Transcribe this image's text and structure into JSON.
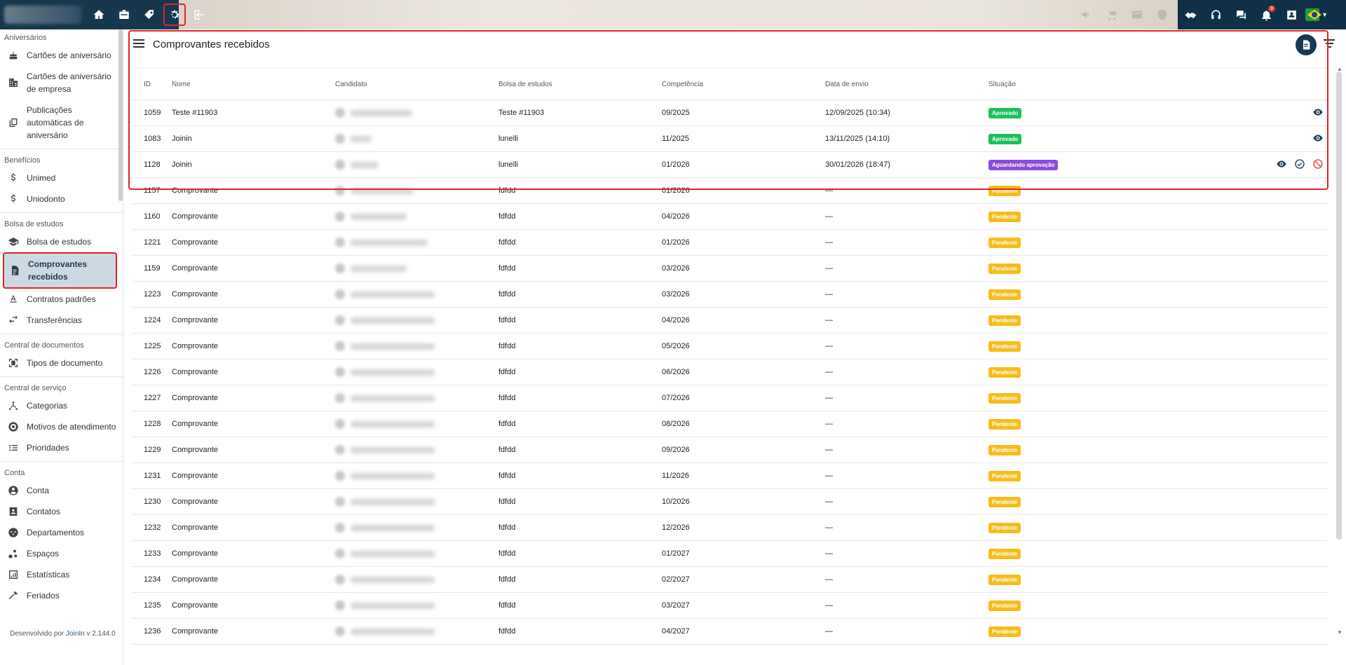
{
  "topbar": {
    "left_icons": [
      "home-icon",
      "briefcase-icon",
      "tag-icon",
      "gear-icon",
      "login-icon"
    ],
    "active_icon": "gear-icon",
    "mid_icons": [
      "megaphone-icon",
      "cart-icon",
      "card-icon",
      "shield-icon"
    ],
    "right_icons": [
      "handshake-icon",
      "headset-icon",
      "chat-icon",
      "bell-icon",
      "badge-icon"
    ],
    "notification_count": "9"
  },
  "sidebar": {
    "sections": [
      {
        "title": "Aniversários",
        "items": [
          {
            "label": "Cartões de aniversário",
            "icon": "cake-icon"
          },
          {
            "label": "Cartões de aniversário de empresa",
            "icon": "building-icon"
          },
          {
            "label": "Publicações automáticas de aniversário",
            "icon": "copy-icon"
          }
        ]
      },
      {
        "title": "Benefícios",
        "items": [
          {
            "label": "Unimed",
            "icon": "dollar-icon"
          },
          {
            "label": "Uniodonto",
            "icon": "dollar-icon"
          }
        ]
      },
      {
        "title": "Bolsa de estudos",
        "items": [
          {
            "label": "Bolsa de estudos",
            "icon": "graduation-icon"
          },
          {
            "label": "Comprovantes recebidos",
            "icon": "document-icon",
            "active": true
          },
          {
            "label": "Contratos padrões",
            "icon": "text-format-icon"
          },
          {
            "label": "Transferências",
            "icon": "swap-icon"
          }
        ]
      },
      {
        "title": "Central de documentos",
        "items": [
          {
            "label": "Tipos de documento",
            "icon": "doc-scan-icon"
          }
        ]
      },
      {
        "title": "Central de serviço",
        "items": [
          {
            "label": "Categorias",
            "icon": "hub-icon"
          },
          {
            "label": "Motivos de atendimento",
            "icon": "target-icon"
          },
          {
            "label": "Prioridades",
            "icon": "list-priority-icon"
          }
        ]
      },
      {
        "title": "Conta",
        "items": [
          {
            "label": "Conta",
            "icon": "account-icon"
          },
          {
            "label": "Contatos",
            "icon": "contacts-icon"
          },
          {
            "label": "Departamentos",
            "icon": "departments-icon"
          },
          {
            "label": "Espaços",
            "icon": "spaces-icon"
          },
          {
            "label": "Estatísticas",
            "icon": "stats-icon"
          },
          {
            "label": "Feriados",
            "icon": "holiday-icon"
          }
        ]
      }
    ],
    "footer_prefix": "Desenvolvido por",
    "footer_brand": "JoinIn",
    "footer_version": "v 2.144.0"
  },
  "main": {
    "title": "Comprovantes recebidos",
    "columns": [
      "ID",
      "Nome",
      "Candidato",
      "Bolsa de estudos",
      "Competência",
      "Data de envio",
      "Situação"
    ],
    "rows": [
      {
        "id": "1059",
        "nome": "Teste #11903",
        "bolsa": "Teste #11903",
        "comp": "09/2025",
        "data": "12/09/2025 (10:34)",
        "status": "Aprovado",
        "color": "green",
        "actions": [
          "view-icon"
        ]
      },
      {
        "id": "1083",
        "nome": "Joinin",
        "bolsa": "lunelli",
        "comp": "11/2025",
        "data": "13/11/2025 (14:10)",
        "status": "Aprovado",
        "color": "green",
        "actions": [
          "view-icon"
        ]
      },
      {
        "id": "1128",
        "nome": "Joinin",
        "bolsa": "lunelli",
        "comp": "01/2026",
        "data": "30/01/2026 (18:47)",
        "status": "Aguardando aprovação",
        "color": "purple",
        "actions": [
          "view-icon",
          "approve-icon",
          "reject-icon"
        ]
      },
      {
        "id": "1157",
        "nome": "Comprovante",
        "bolsa": "fdfdd",
        "comp": "01/2026",
        "data": "—",
        "status": "Pendente",
        "color": "yellow",
        "actions": []
      },
      {
        "id": "1160",
        "nome": "Comprovante",
        "bolsa": "fdfdd",
        "comp": "04/2026",
        "data": "—",
        "status": "Pendente",
        "color": "yellow",
        "actions": []
      },
      {
        "id": "1221",
        "nome": "Comprovante",
        "bolsa": "fdfdd",
        "comp": "01/2026",
        "data": "—",
        "status": "Pendente",
        "color": "yellow",
        "actions": []
      },
      {
        "id": "1159",
        "nome": "Comprovante",
        "bolsa": "fdfdd",
        "comp": "03/2026",
        "data": "—",
        "status": "Pendente",
        "color": "yellow",
        "actions": []
      },
      {
        "id": "1223",
        "nome": "Comprovante",
        "bolsa": "fdfdd",
        "comp": "03/2026",
        "data": "—",
        "status": "Pendente",
        "color": "yellow",
        "actions": []
      },
      {
        "id": "1224",
        "nome": "Comprovante",
        "bolsa": "fdfdd",
        "comp": "04/2026",
        "data": "—",
        "status": "Pendente",
        "color": "yellow",
        "actions": []
      },
      {
        "id": "1225",
        "nome": "Comprovante",
        "bolsa": "fdfdd",
        "comp": "05/2026",
        "data": "—",
        "status": "Pendente",
        "color": "yellow",
        "actions": []
      },
      {
        "id": "1226",
        "nome": "Comprovante",
        "bolsa": "fdfdd",
        "comp": "06/2026",
        "data": "—",
        "status": "Pendente",
        "color": "yellow",
        "actions": []
      },
      {
        "id": "1227",
        "nome": "Comprovante",
        "bolsa": "fdfdd",
        "comp": "07/2026",
        "data": "—",
        "status": "Pendente",
        "color": "yellow",
        "actions": []
      },
      {
        "id": "1228",
        "nome": "Comprovante",
        "bolsa": "fdfdd",
        "comp": "08/2026",
        "data": "—",
        "status": "Pendente",
        "color": "yellow",
        "actions": []
      },
      {
        "id": "1229",
        "nome": "Comprovante",
        "bolsa": "fdfdd",
        "comp": "09/2026",
        "data": "—",
        "status": "Pendente",
        "color": "yellow",
        "actions": []
      },
      {
        "id": "1231",
        "nome": "Comprovante",
        "bolsa": "fdfdd",
        "comp": "11/2026",
        "data": "—",
        "status": "Pendente",
        "color": "yellow",
        "actions": []
      },
      {
        "id": "1230",
        "nome": "Comprovante",
        "bolsa": "fdfdd",
        "comp": "10/2026",
        "data": "—",
        "status": "Pendente",
        "color": "yellow",
        "actions": []
      },
      {
        "id": "1232",
        "nome": "Comprovante",
        "bolsa": "fdfdd",
        "comp": "12/2026",
        "data": "—",
        "status": "Pendente",
        "color": "yellow",
        "actions": []
      },
      {
        "id": "1233",
        "nome": "Comprovante",
        "bolsa": "fdfdd",
        "comp": "01/2027",
        "data": "—",
        "status": "Pendente",
        "color": "yellow",
        "actions": []
      },
      {
        "id": "1234",
        "nome": "Comprovante",
        "bolsa": "fdfdd",
        "comp": "02/2027",
        "data": "—",
        "status": "Pendente",
        "color": "yellow",
        "actions": []
      },
      {
        "id": "1235",
        "nome": "Comprovante",
        "bolsa": "fdfdd",
        "comp": "03/2027",
        "data": "—",
        "status": "Pendente",
        "color": "yellow",
        "actions": []
      },
      {
        "id": "1236",
        "nome": "Comprovante",
        "bolsa": "fdfdd",
        "comp": "04/2027",
        "data": "—",
        "status": "Pendente",
        "color": "yellow",
        "actions": []
      }
    ]
  },
  "colors": {
    "accent": "#163a55",
    "approved": "#1dbf5c",
    "waiting": "#8b4ddb",
    "pending": "#f5bd1c",
    "highlight": "#e02424"
  }
}
